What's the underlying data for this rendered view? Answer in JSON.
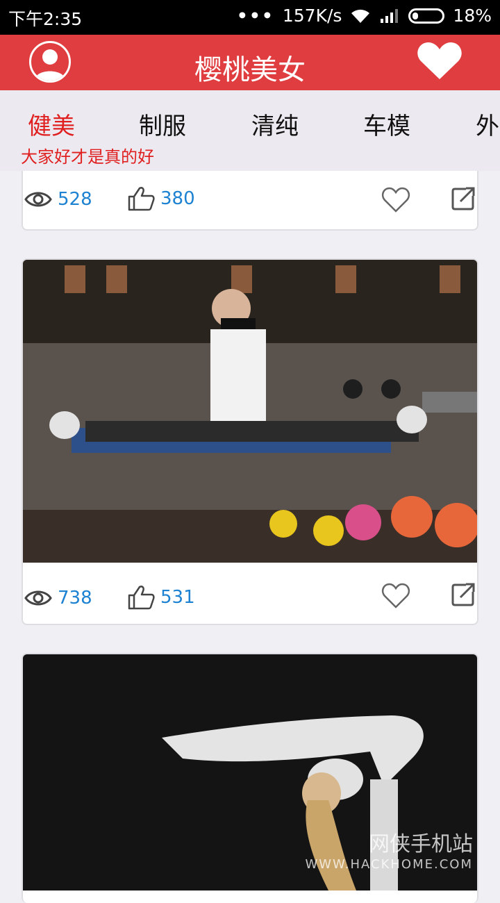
{
  "status": {
    "time": "下午2:35",
    "dots": "•••",
    "speed": "157K/s",
    "battery": "18%"
  },
  "appbar": {
    "title": "樱桃美女"
  },
  "tabs": {
    "items": [
      "健美",
      "制服",
      "清纯",
      "车模",
      "外"
    ],
    "subtitle": "大家好才是真的好"
  },
  "cards": [
    {
      "views": "528",
      "likes": "380"
    },
    {
      "views": "738",
      "likes": "531"
    }
  ],
  "watermark": {
    "cn": "网侠手机站",
    "en": "WWW.HACKHOME.COM"
  },
  "colors": {
    "accent": "#df3d3f",
    "tab_active": "#e02020",
    "count": "#1e82d2"
  }
}
